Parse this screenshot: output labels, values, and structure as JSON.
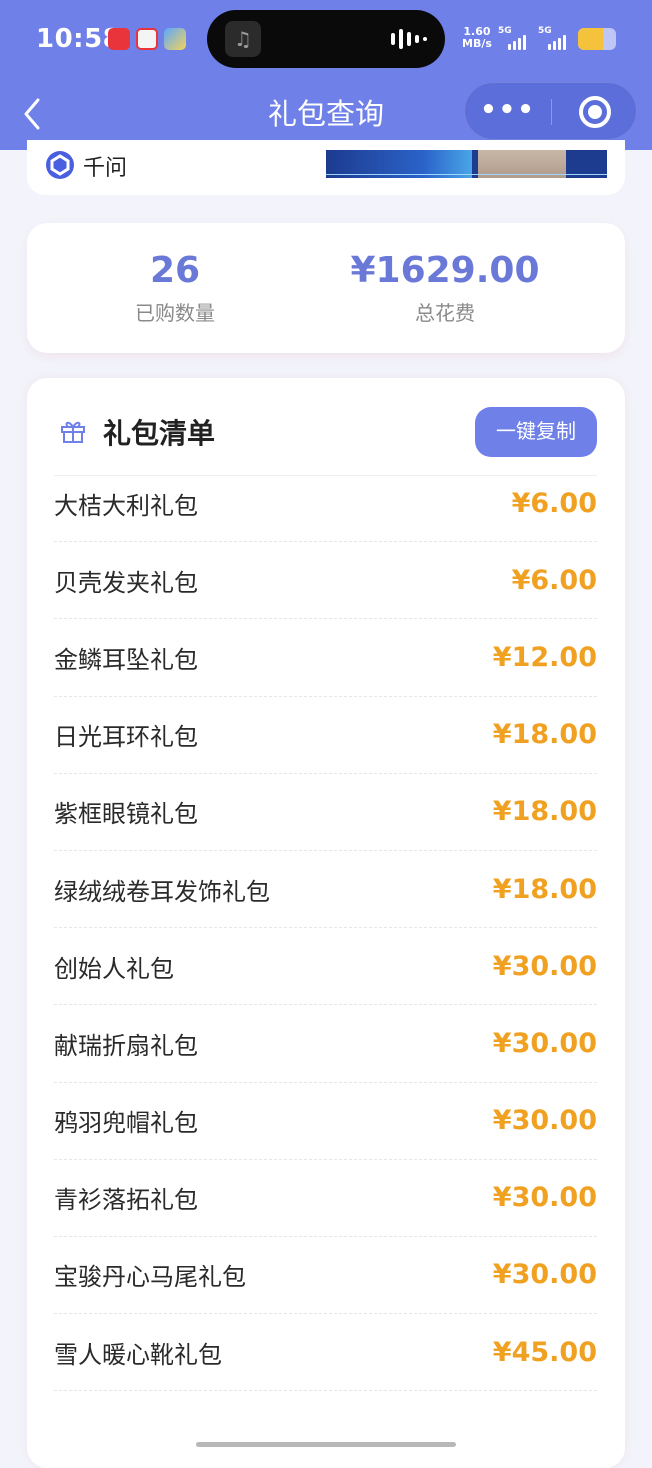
{
  "status_bar": {
    "time": "10:58",
    "network_speed_top": "1.60",
    "network_speed_bottom": "MB/s",
    "sim1": "5G",
    "sim2": "5G",
    "battery_level": 0.65,
    "battery_color": "#f5c33b"
  },
  "navbar": {
    "title": "礼包查询",
    "back_icon": "chevron-left-icon",
    "more_label": "•••",
    "close_icon": "target-icon",
    "bg_color": "#6f80e9"
  },
  "top_card": {
    "label": "千问",
    "icon": "qianwen-logo-icon"
  },
  "stats": {
    "count_value": "26",
    "count_label": "已购数量",
    "total_value": "¥1629.00",
    "total_label": "总花费",
    "value_color": "#6a79d8"
  },
  "list": {
    "title": "礼包清单",
    "icon": "gift-icon",
    "copy_button": "一键复制",
    "price_color": "#f0a122",
    "items": [
      {
        "name": "大桔大利礼包",
        "price": "¥6.00"
      },
      {
        "name": "贝壳发夹礼包",
        "price": "¥6.00"
      },
      {
        "name": "金鳞耳坠礼包",
        "price": "¥12.00"
      },
      {
        "name": "日光耳环礼包",
        "price": "¥18.00"
      },
      {
        "name": "紫框眼镜礼包",
        "price": "¥18.00"
      },
      {
        "name": "绿绒绒卷耳发饰礼包",
        "price": "¥18.00"
      },
      {
        "name": "创始人礼包",
        "price": "¥30.00"
      },
      {
        "name": "献瑞折扇礼包",
        "price": "¥30.00"
      },
      {
        "name": "鸦羽兜帽礼包",
        "price": "¥30.00"
      },
      {
        "name": "青衫落拓礼包",
        "price": "¥30.00"
      },
      {
        "name": "宝骏丹心马尾礼包",
        "price": "¥30.00"
      },
      {
        "name": "雪人暖心靴礼包",
        "price": "¥45.00"
      }
    ]
  }
}
